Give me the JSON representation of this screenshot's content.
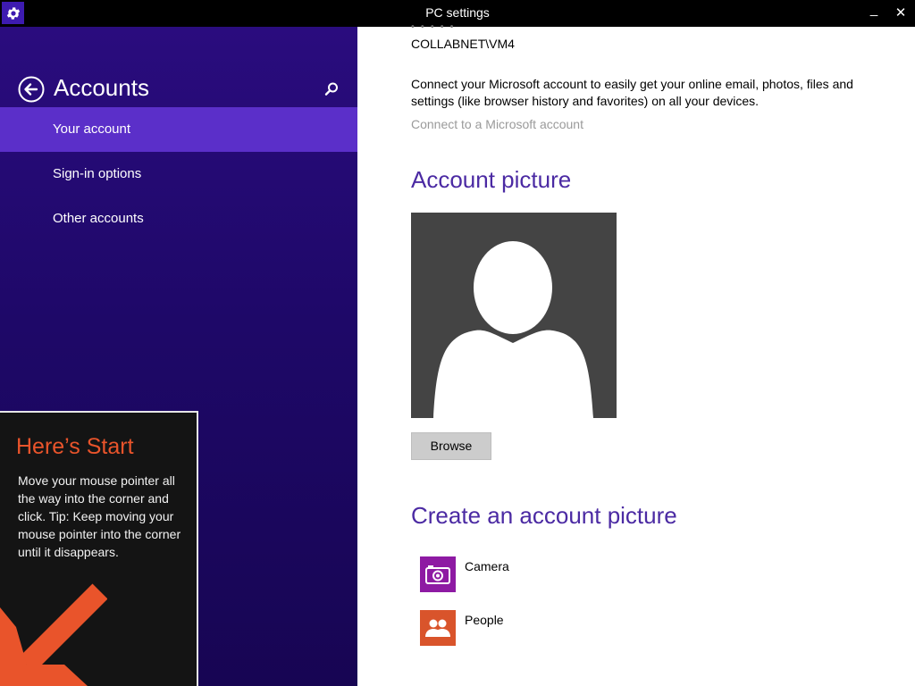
{
  "window": {
    "title": "PC settings",
    "minimize_glyph": "_",
    "close_glyph": "✕"
  },
  "nav": {
    "title": "Accounts",
    "items": [
      {
        "label": "Your account",
        "selected": true
      },
      {
        "label": "Sign-in options",
        "selected": false
      },
      {
        "label": "Other accounts",
        "selected": false
      }
    ]
  },
  "tip": {
    "title": "Here’s Start",
    "body": "Move your mouse pointer all the way into the corner and click. Tip: Keep moving your mouse pointer into the corner until it disappears."
  },
  "account": {
    "dots": "• • • • •",
    "name": "COLLABNET\\VM4",
    "description": "Connect your Microsoft account to easily get your online email, photos, files and settings (like browser history and favorites) on all your devices.",
    "connect_link": "Connect to a Microsoft account"
  },
  "picture_section": {
    "title": "Account picture",
    "browse_label": "Browse"
  },
  "create_section": {
    "title": "Create an account picture",
    "apps": [
      {
        "label": "Camera",
        "icon": "camera-icon",
        "color": "#8e1aa3"
      },
      {
        "label": "People",
        "icon": "people-icon",
        "color": "#d9542b"
      }
    ]
  },
  "colors": {
    "accent": "#5b2fc9",
    "nav_bg": "#1e0868",
    "heading": "#4b2aa3",
    "tip_title": "#e9542b"
  }
}
